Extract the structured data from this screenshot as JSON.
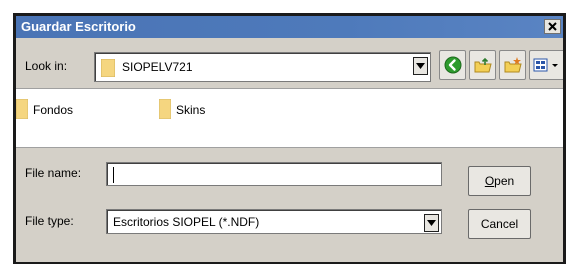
{
  "dialog": {
    "title": "Guardar Escritorio",
    "close_icon": "close-icon"
  },
  "look_in": {
    "label": "Look in:",
    "value": "SIOPELV721"
  },
  "toolbar": {
    "buttons": [
      {
        "name": "back-button",
        "icon": "back-arrow-icon",
        "color": "#2e9b2e"
      },
      {
        "name": "up-folder-button",
        "icon": "up-folder-icon"
      },
      {
        "name": "new-folder-button",
        "icon": "new-folder-icon"
      },
      {
        "name": "view-menu-button",
        "icon": "view-menu-icon"
      }
    ]
  },
  "files": [
    {
      "name": "Fondos",
      "icon": "folder-icon"
    },
    {
      "name": "Skins",
      "icon": "folder-icon"
    }
  ],
  "file_name": {
    "label": "File name:",
    "value": ""
  },
  "file_type": {
    "label": "File type:",
    "value": "Escritorios SIOPEL (*.NDF)"
  },
  "actions": {
    "open_mnemonic": "O",
    "open_rest": "pen",
    "cancel_label": "Cancel"
  },
  "colors": {
    "titlebar": "#4e7abb",
    "dialog_bg": "#d4d0c8",
    "folder": "#f5d680"
  }
}
